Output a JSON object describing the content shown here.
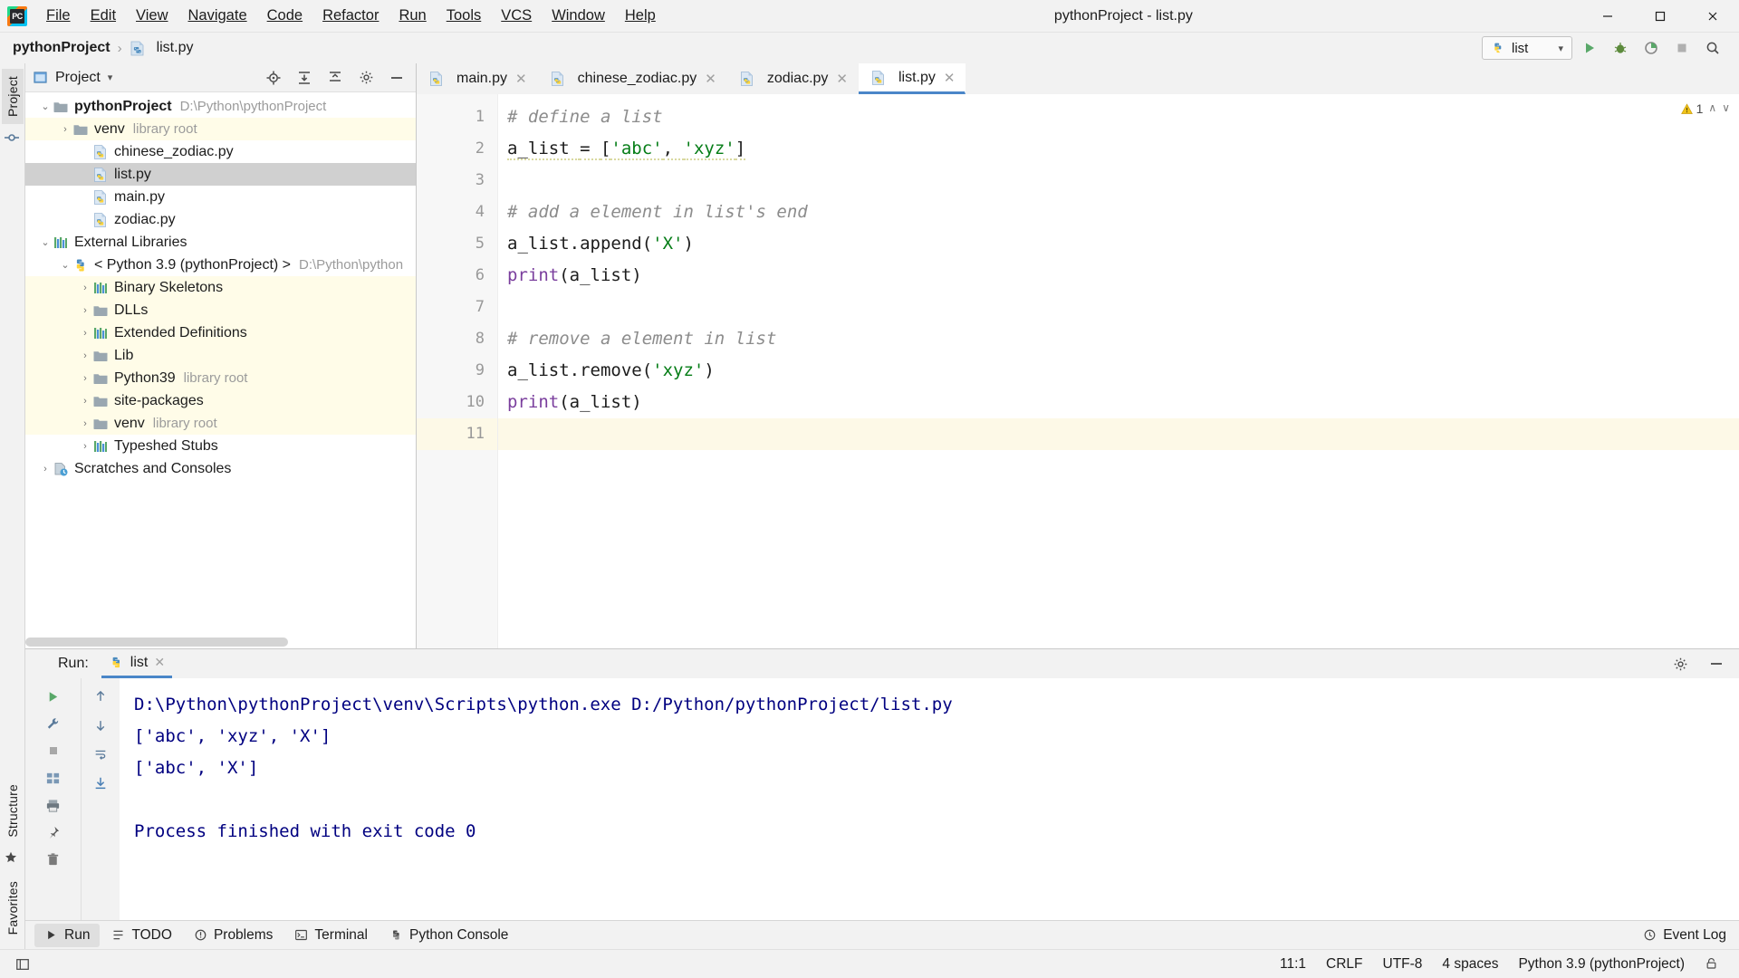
{
  "window": {
    "title": "pythonProject - list.py",
    "minimize": "─",
    "maximize": "❐",
    "close": "✕"
  },
  "menubar": {
    "items": [
      {
        "label": "File"
      },
      {
        "label": "Edit"
      },
      {
        "label": "View"
      },
      {
        "label": "Navigate"
      },
      {
        "label": "Code"
      },
      {
        "label": "Refactor"
      },
      {
        "label": "Run"
      },
      {
        "label": "Tools"
      },
      {
        "label": "VCS"
      },
      {
        "label": "Window"
      },
      {
        "label": "Help"
      }
    ]
  },
  "breadcrumb": {
    "project": "pythonProject",
    "separator": "›",
    "file": "list.py"
  },
  "navbar": {
    "run_config": "list",
    "run_config_caret": "▾",
    "buttons": [
      "run-button",
      "debug-button",
      "run-coverage-button",
      "stop-button",
      "search-everywhere-button"
    ]
  },
  "left_strip": {
    "project_tab": "Project",
    "structure_tab": "Structure",
    "favorites_tab": "Favorites"
  },
  "project_panel": {
    "title": "Project",
    "title_caret": "▾",
    "header_buttons": [
      "locate-icon",
      "expand-all-icon",
      "collapse-all-icon",
      "settings-icon",
      "hide-icon"
    ],
    "tree": [
      {
        "depth": 0,
        "arrow": "⌄",
        "icon": "folder",
        "label": "pythonProject",
        "bold": true,
        "meta": "D:\\Python\\pythonProject",
        "state": "normal"
      },
      {
        "depth": 1,
        "arrow": "›",
        "icon": "folder",
        "label": "venv",
        "bold": false,
        "meta": "library root",
        "state": "hl"
      },
      {
        "depth": 2,
        "arrow": "",
        "icon": "py",
        "label": "chinese_zodiac.py",
        "bold": false,
        "meta": "",
        "state": "normal"
      },
      {
        "depth": 2,
        "arrow": "",
        "icon": "py",
        "label": "list.py",
        "bold": false,
        "meta": "",
        "state": "sel"
      },
      {
        "depth": 2,
        "arrow": "",
        "icon": "py",
        "label": "main.py",
        "bold": false,
        "meta": "",
        "state": "normal"
      },
      {
        "depth": 2,
        "arrow": "",
        "icon": "py",
        "label": "zodiac.py",
        "bold": false,
        "meta": "",
        "state": "normal"
      },
      {
        "depth": 0,
        "arrow": "⌄",
        "icon": "lib",
        "label": "External Libraries",
        "bold": false,
        "meta": "",
        "state": "normal"
      },
      {
        "depth": 1,
        "arrow": "⌄",
        "icon": "python",
        "label": "< Python 3.9 (pythonProject) >",
        "bold": false,
        "meta": "D:\\Python\\python",
        "state": "normal"
      },
      {
        "depth": 2,
        "arrow": "›",
        "icon": "lib",
        "label": "Binary Skeletons",
        "bold": false,
        "meta": "",
        "state": "hl"
      },
      {
        "depth": 2,
        "arrow": "›",
        "icon": "folder",
        "label": "DLLs",
        "bold": false,
        "meta": "",
        "state": "hl"
      },
      {
        "depth": 2,
        "arrow": "›",
        "icon": "lib",
        "label": "Extended Definitions",
        "bold": false,
        "meta": "",
        "state": "hl"
      },
      {
        "depth": 2,
        "arrow": "›",
        "icon": "folder",
        "label": "Lib",
        "bold": false,
        "meta": "",
        "state": "hl"
      },
      {
        "depth": 2,
        "arrow": "›",
        "icon": "folder",
        "label": "Python39",
        "bold": false,
        "meta": "library root",
        "state": "hl"
      },
      {
        "depth": 2,
        "arrow": "›",
        "icon": "folder",
        "label": "site-packages",
        "bold": false,
        "meta": "",
        "state": "hl"
      },
      {
        "depth": 2,
        "arrow": "›",
        "icon": "folder",
        "label": "venv",
        "bold": false,
        "meta": "library root",
        "state": "hl"
      },
      {
        "depth": 2,
        "arrow": "›",
        "icon": "lib",
        "label": "Typeshed Stubs",
        "bold": false,
        "meta": "",
        "state": "normal"
      },
      {
        "depth": 0,
        "arrow": "›",
        "icon": "scratch",
        "label": "Scratches and Consoles",
        "bold": false,
        "meta": "",
        "state": "normal"
      }
    ]
  },
  "editor": {
    "tabs": [
      {
        "label": "main.py",
        "active": false,
        "close": "✕"
      },
      {
        "label": "chinese_zodiac.py",
        "active": false,
        "close": "✕"
      },
      {
        "label": "zodiac.py",
        "active": false,
        "close": "✕"
      },
      {
        "label": "list.py",
        "active": true,
        "close": "✕"
      }
    ],
    "warning_count": "1",
    "warning_up": "∧",
    "warning_down": "∨",
    "line_numbers": [
      "1",
      "2",
      "3",
      "4",
      "5",
      "6",
      "7",
      "8",
      "9",
      "10",
      "11"
    ],
    "current_line": 11,
    "lines": [
      {
        "n": 1,
        "tokens": [
          {
            "t": "# define a list",
            "c": "cm"
          }
        ]
      },
      {
        "n": 2,
        "tokens": [
          {
            "t": "a_list ",
            "c": "cn"
          },
          {
            "t": "= ",
            "c": "cn"
          },
          {
            "t": "[",
            "c": "cn"
          },
          {
            "t": "'abc'",
            "c": "cs"
          },
          {
            "t": ", ",
            "c": "cn"
          },
          {
            "t": "'xyz'",
            "c": "cs"
          },
          {
            "t": "]",
            "c": "cn"
          }
        ]
      },
      {
        "n": 3,
        "tokens": []
      },
      {
        "n": 4,
        "tokens": [
          {
            "t": "# add a element in list's end",
            "c": "cm"
          }
        ]
      },
      {
        "n": 5,
        "tokens": [
          {
            "t": "a_list.append(",
            "c": "cn"
          },
          {
            "t": "'X'",
            "c": "cs"
          },
          {
            "t": ")",
            "c": "cn"
          }
        ]
      },
      {
        "n": 6,
        "tokens": [
          {
            "t": "print",
            "c": "cf"
          },
          {
            "t": "(a_list)",
            "c": "cn"
          }
        ]
      },
      {
        "n": 7,
        "tokens": []
      },
      {
        "n": 8,
        "tokens": [
          {
            "t": "# remove a element in list",
            "c": "cm"
          }
        ]
      },
      {
        "n": 9,
        "tokens": [
          {
            "t": "a_list.remove(",
            "c": "cn"
          },
          {
            "t": "'xyz'",
            "c": "cs"
          },
          {
            "t": ")",
            "c": "cn"
          }
        ]
      },
      {
        "n": 10,
        "tokens": [
          {
            "t": "print",
            "c": "cf"
          },
          {
            "t": "(a_list)",
            "c": "cn"
          }
        ]
      },
      {
        "n": 11,
        "tokens": []
      }
    ]
  },
  "run_panel": {
    "label": "Run:",
    "tab_label": "list",
    "tab_close": "✕",
    "gutter_buttons": [
      "rerun-button",
      "up-arrow-button",
      "down-arrow-button",
      "stop-button",
      "wrench-button",
      "filter-button",
      "scroll-to-end-button",
      "print-button",
      "pin-button",
      "trash-button",
      "layout-button"
    ],
    "settings_icon": "gear-icon",
    "hide_icon": "hide-icon",
    "output": [
      "D:\\Python\\pythonProject\\venv\\Scripts\\python.exe D:/Python/pythonProject/list.py",
      "['abc', 'xyz', 'X']",
      "['abc', 'X']",
      "",
      "Process finished with exit code 0"
    ]
  },
  "bottom_bar": {
    "items": [
      {
        "label": "Run",
        "icon": "run-icon",
        "active": true
      },
      {
        "label": "TODO",
        "icon": "todo-icon",
        "active": false
      },
      {
        "label": "Problems",
        "icon": "problems-icon",
        "active": false
      },
      {
        "label": "Terminal",
        "icon": "terminal-icon",
        "active": false
      },
      {
        "label": "Python Console",
        "icon": "python-console-icon",
        "active": false
      }
    ],
    "event_log": "Event Log"
  },
  "status_bar": {
    "caret": "11:1",
    "line_sep": "CRLF",
    "encoding": "UTF-8",
    "indent": "4 spaces",
    "interpreter": "Python 3.9 (pythonProject)",
    "lock_icon": "lock-icon"
  },
  "colors": {
    "accent": "#4a86c8",
    "string": "#067d17",
    "keyword": "#0033b3",
    "function": "#7a3e9d",
    "comment": "#8c8c8c",
    "console_text": "#000080",
    "highlight_row": "#fffce8",
    "selected_row": "#d0d0d0",
    "panel_bg": "#f2f2f2"
  }
}
